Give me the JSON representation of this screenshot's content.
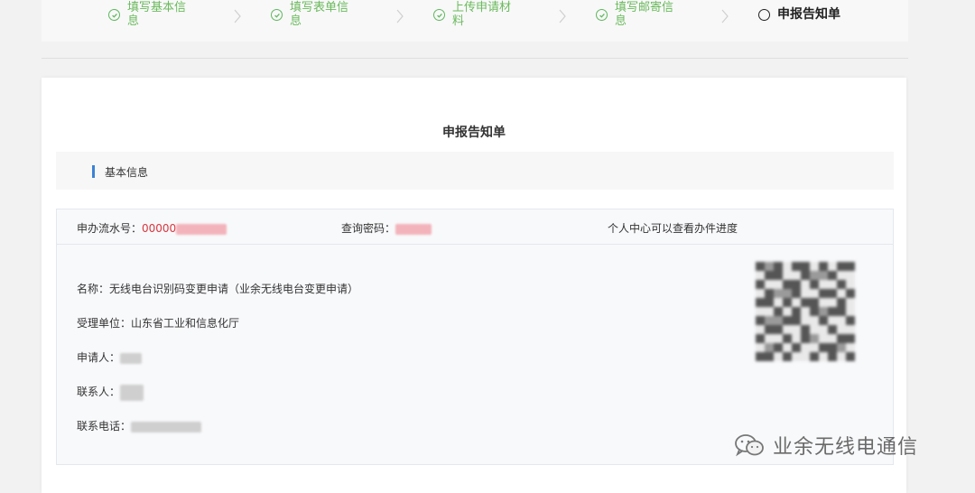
{
  "stepper": {
    "steps": [
      {
        "label": "填写基本信息",
        "status": "done"
      },
      {
        "label": "填写表单信息",
        "status": "done"
      },
      {
        "label": "上传申请材料",
        "status": "done"
      },
      {
        "label": "填写邮寄信息",
        "status": "done"
      },
      {
        "label": "申报告知单",
        "status": "current"
      }
    ]
  },
  "doc": {
    "title": "申报告知单",
    "section_title": "基本信息"
  },
  "info": {
    "serial_label": "申办流水号：",
    "serial_visible": "00000",
    "password_label": "查询密码：",
    "progress_hint": "个人中心可以查看办件进度",
    "name_line": "名称：无线电台识别码变更申请（业余无线电台变更申请）",
    "unit_line": "受理单位：山东省工业和信息化厅",
    "applicant_label": "申请人：",
    "contact_label": "联系人：",
    "phone_label": "联系电话："
  },
  "watermark": {
    "text": "业余无线电通信"
  },
  "colors": {
    "done_green": "#5fb85c",
    "accent_blue": "#3b82d6",
    "serial_red": "#d9363e"
  }
}
